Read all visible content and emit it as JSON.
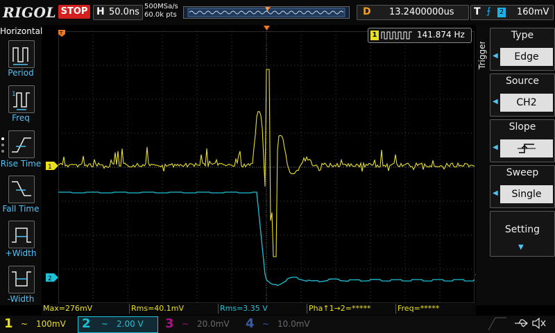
{
  "top": {
    "brand": "RIGOL",
    "run_state": "STOP",
    "horizontal": {
      "label": "H",
      "timebase": "50.0ns"
    },
    "sample_rate": "500MSa/s",
    "memory_depth": "60.0k pts",
    "delay": {
      "label": "D",
      "value": "13.2400000us"
    },
    "trigger": {
      "label": "T",
      "source": "2",
      "level": "160mV"
    }
  },
  "left_menu": {
    "title": "Horizontal",
    "items": [
      {
        "label": "Period",
        "icon": "period-icon"
      },
      {
        "label": "Freq",
        "icon": "freq-icon"
      },
      {
        "label": "Rise Time",
        "icon": "rise-time-icon"
      },
      {
        "label": "Fall Time",
        "icon": "fall-time-icon"
      },
      {
        "label": "+Width",
        "icon": "pos-width-icon"
      },
      {
        "label": "-Width",
        "icon": "neg-width-icon"
      }
    ]
  },
  "freq_counter": {
    "channel": "1",
    "value": "141.874 Hz"
  },
  "markers": {
    "ch1": "1",
    "ch2": "2",
    "trigger": "T"
  },
  "right_menu": {
    "side_title": "Trigger",
    "type": {
      "title": "Type",
      "value": "Edge"
    },
    "source": {
      "title": "Source",
      "value": "CH2"
    },
    "slope": {
      "title": "Slope",
      "icon": "rising-edge-icon"
    },
    "sweep": {
      "title": "Sweep",
      "value": "Single"
    },
    "setting": {
      "title": "Setting"
    }
  },
  "measurements": [
    {
      "text": "Max=276mV",
      "color": "#e8e020"
    },
    {
      "text": "Rms=40.1mV",
      "color": "#e8e020"
    },
    {
      "text": "Rms=3.35 V",
      "color": "#1ec2d6"
    },
    {
      "text": "Pha↑1→2=*****",
      "color": "#e8e020"
    },
    {
      "text": "Freq=*****",
      "color": "#e8e020"
    }
  ],
  "channels": [
    {
      "num": "1",
      "coupling": "~",
      "scale": "100mV",
      "color": "#e8e020"
    },
    {
      "num": "2",
      "coupling": "~",
      "scale": "2.00 V",
      "color": "#1ec2d6"
    },
    {
      "num": "3",
      "coupling": "~",
      "scale": "20.0mV",
      "color": "#b0108a"
    },
    {
      "num": "4",
      "coupling": "~",
      "scale": "10.0mV",
      "color": "#3a5aa8"
    }
  ],
  "colors": {
    "ch1": "#e8e020",
    "ch2": "#1ec2d6",
    "trigger": "#f0a020",
    "accent": "#4fc3f7"
  }
}
